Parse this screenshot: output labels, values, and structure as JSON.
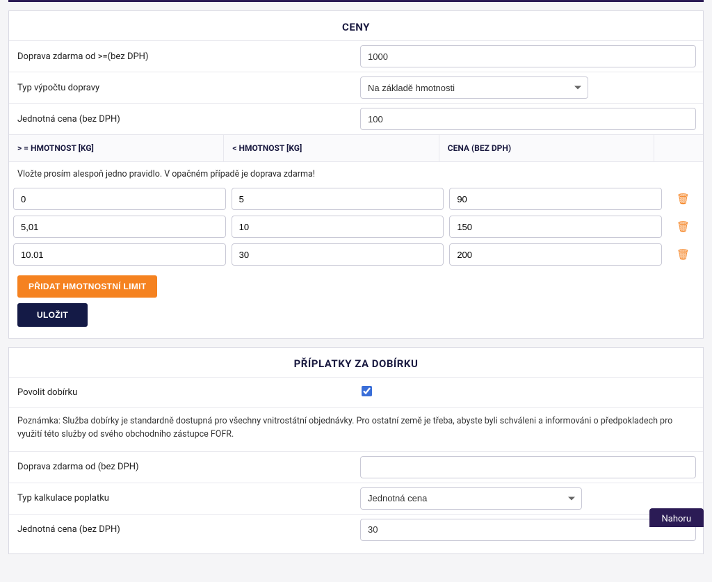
{
  "prices": {
    "title": "CENY",
    "free_shipping_label": "Doprava zdarma od >=(bez DPH)",
    "free_shipping_value": "1000",
    "calc_type_label": "Typ výpočtu dopravy",
    "calc_type_value": "Na základě hmotnosti",
    "flat_rate_label": "Jednotná cena (bez DPH)",
    "flat_rate_value": "100",
    "col_gte": "> = HMOTNOST [KG]",
    "col_lt": "< HMOTNOST [KG]",
    "col_price": "CENA (BEZ DPH)",
    "hint": "Vložte prosím alespoň jedno pravidlo. V opačném případě je doprava zdarma!",
    "rules": [
      {
        "gte": "0",
        "lt": "5",
        "price": "90"
      },
      {
        "gte": "5,01",
        "lt": "10",
        "price": "150"
      },
      {
        "gte": "10.01",
        "lt": "30",
        "price": "200"
      }
    ],
    "add_limit_btn": "PŘIDAT HMOTNOSTNÍ LIMIT",
    "save_btn": "ULOŽIT"
  },
  "cod": {
    "title": "PŘÍPLATKY ZA DOBÍRKU",
    "enable_label": "Povolit dobírku",
    "enable_checked": true,
    "note": "Poznámka: Služba dobírky je standardně dostupná pro všechny vnitrostátní objednávky. Pro ostatní země je třeba, abyste byli schváleni a informováni o předpokladech pro využití této služby od svého obchodního zástupce FOFR.",
    "free_shipping_label": "Doprava zdarma od (bez DPH)",
    "free_shipping_value": "",
    "calc_type_label": "Typ kalkulace poplatku",
    "calc_type_value": "Jednotná cena",
    "flat_rate_label": "Jednotná cena (bez DPH)",
    "flat_rate_value": "30"
  },
  "to_top": "Nahoru"
}
